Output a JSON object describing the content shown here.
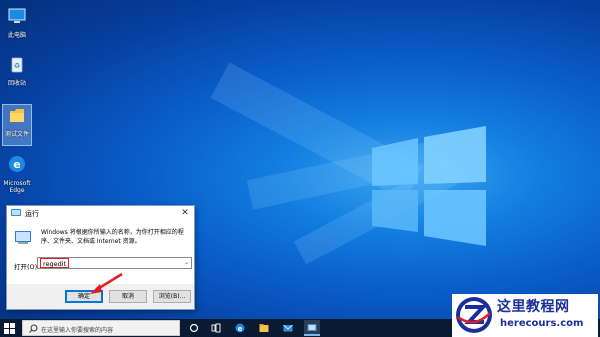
{
  "desktop": {
    "icons": [
      {
        "label": "此电脑",
        "icon": "computer-icon"
      },
      {
        "label": "回收站",
        "icon": "recycle-bin-icon"
      },
      {
        "label": "测试文件",
        "icon": "folder-icon"
      },
      {
        "label": "Microsoft Edge",
        "icon": "edge-icon"
      }
    ]
  },
  "run_dialog": {
    "title": "运行",
    "description": "Windows 将根据你所输入的名称，为你打开相应的程序、文件夹、文档或 Internet 资源。",
    "open_label": "打开(O):",
    "open_value": "regedit",
    "ok_label": "确定",
    "cancel_label": "取消",
    "browse_label": "浏览(B)..."
  },
  "taskbar": {
    "search_placeholder": "在这里输入你要搜索的内容",
    "items": [
      "cortana-icon",
      "task-view-icon",
      "edge-icon",
      "file-explorer-icon",
      "mail-icon",
      "run-icon"
    ]
  },
  "watermark": {
    "title": "这里教程网",
    "url": "herecours.com"
  },
  "colors": {
    "accent": "#0078d7",
    "highlight": "#e02020",
    "taskbar": "#0b1a33",
    "watermark_text": "#1a2f9a"
  }
}
